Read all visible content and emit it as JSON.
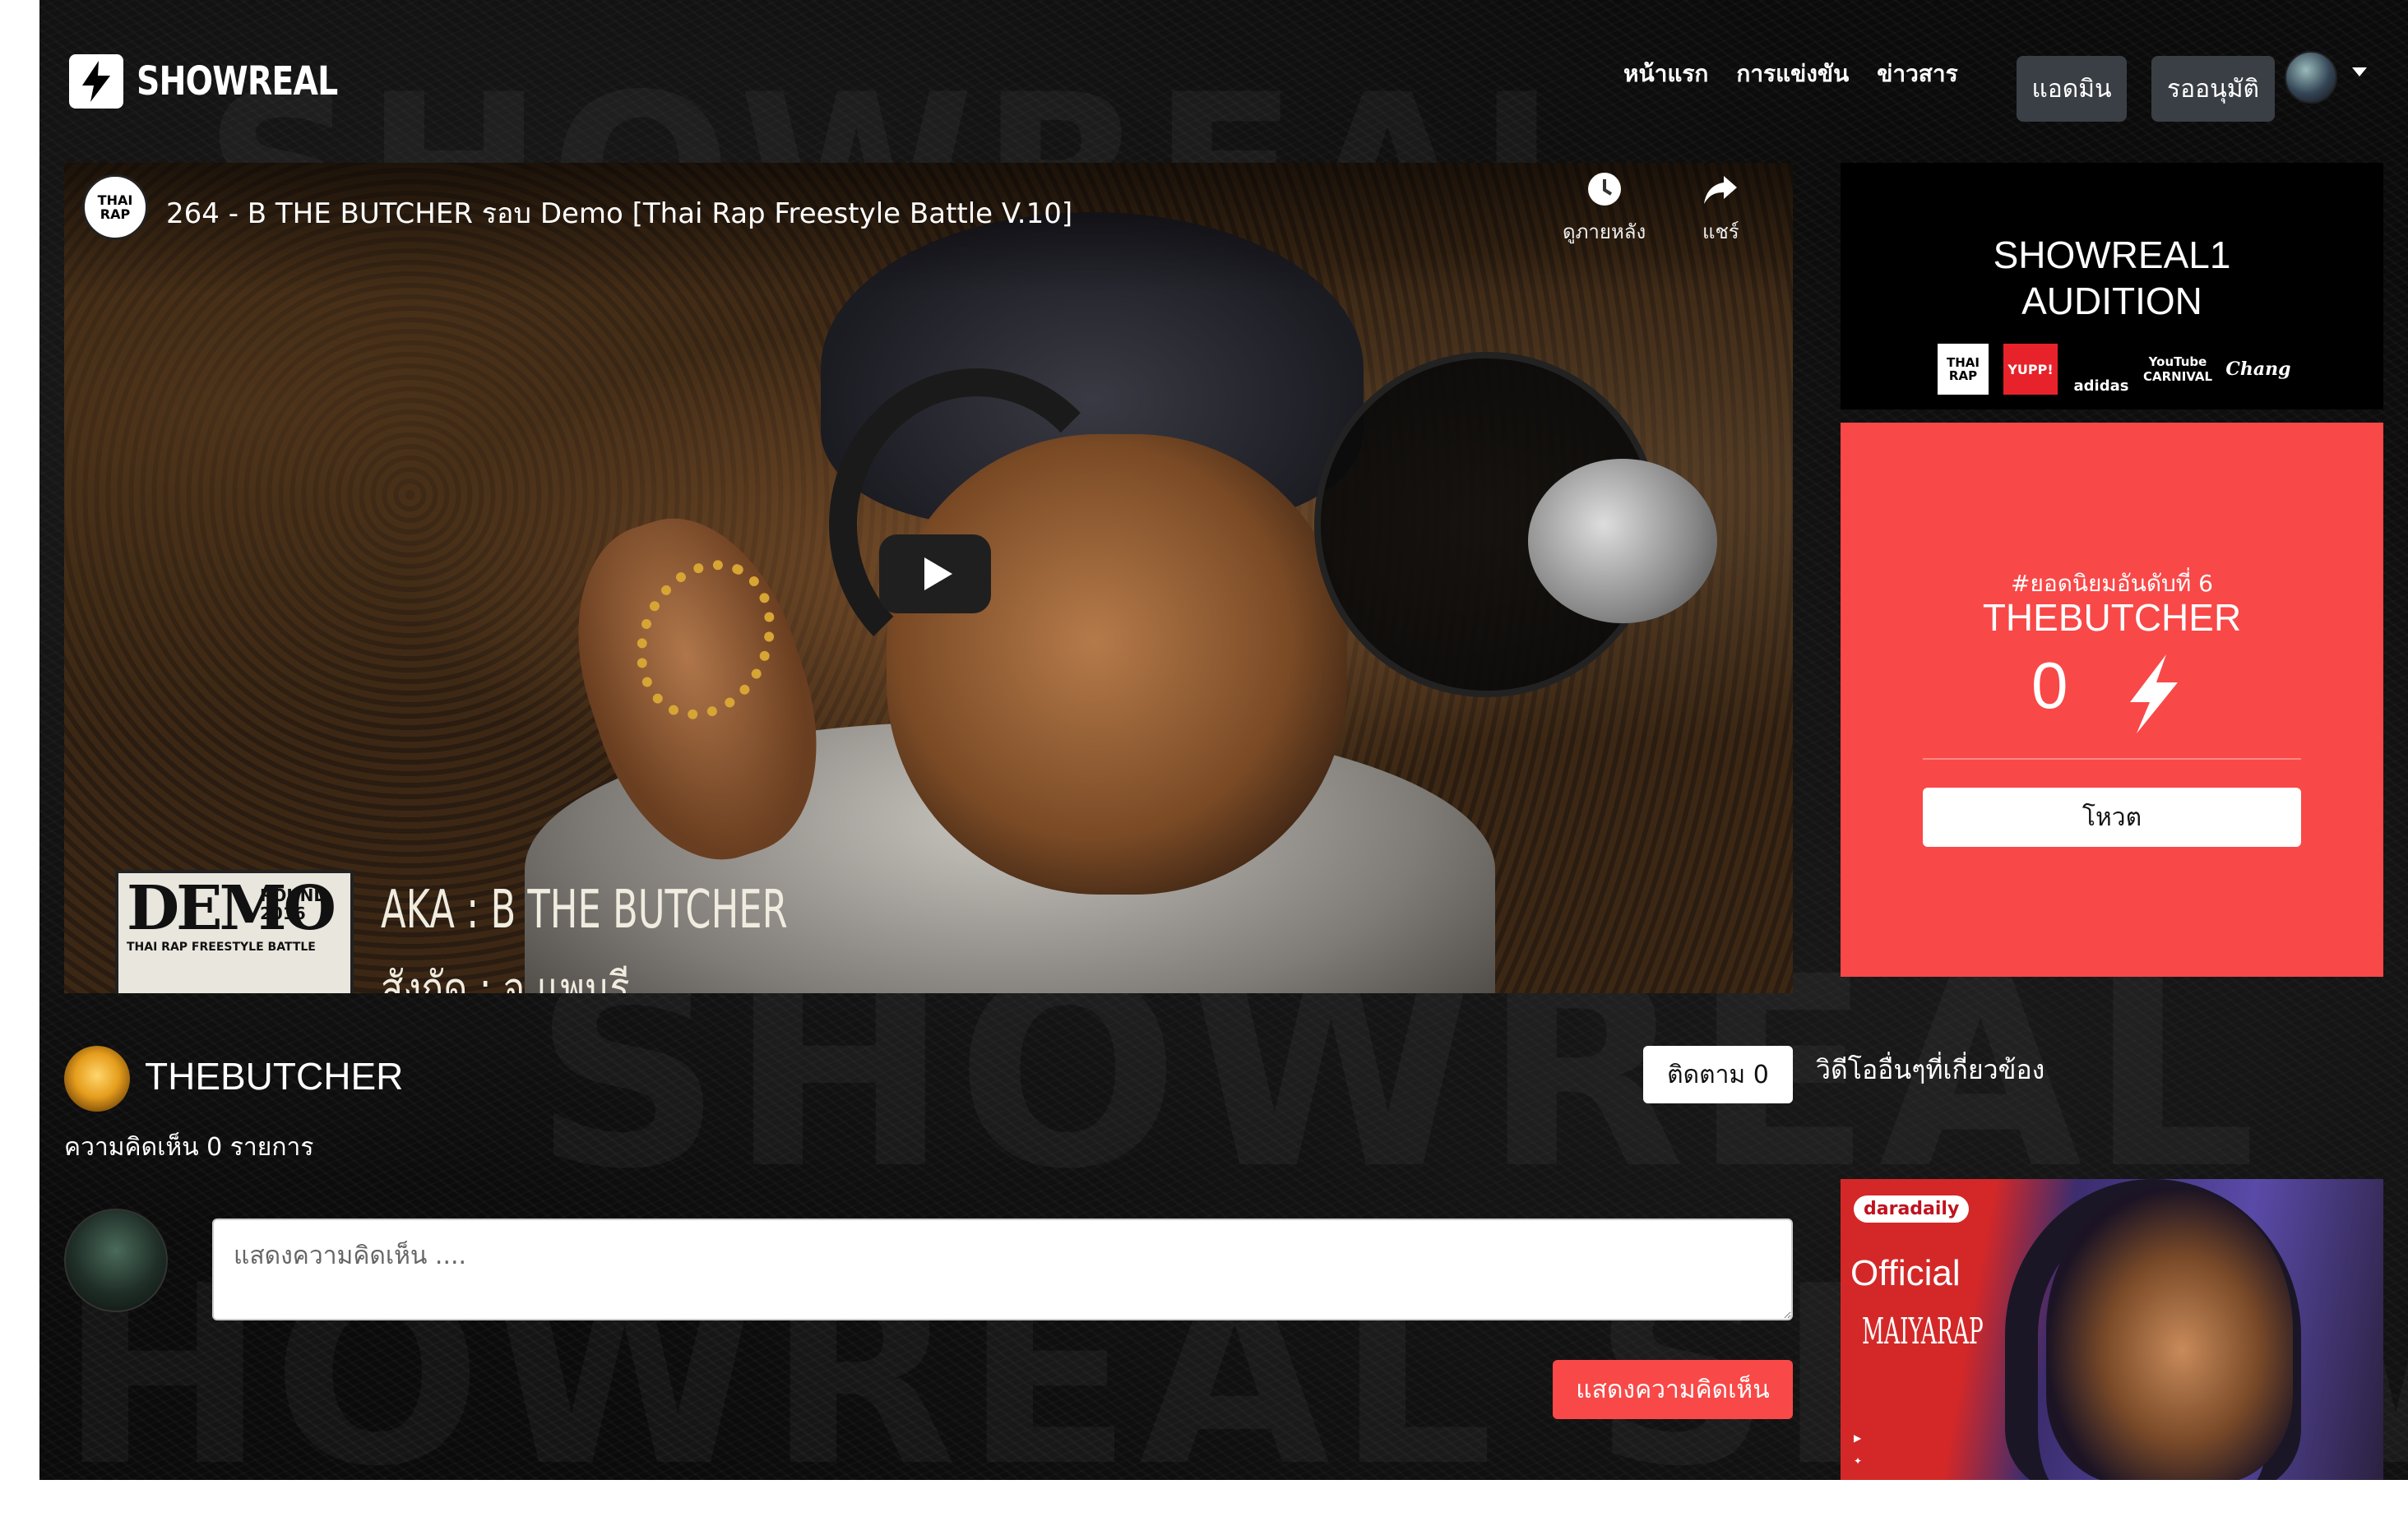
{
  "nav": {
    "logo_text": "SHOWREAL",
    "links": [
      "หน้าแรก",
      "การแข่งขัน",
      "ข่าวสาร"
    ],
    "admin_button": "แอดมิน",
    "pending_button": "รออนุมัติ"
  },
  "video": {
    "channel_badge": "THAI RAP",
    "title": "264 - B THE BUTCHER รอบ Demo [Thai Rap Freestyle Battle V.10]",
    "watch_later": "ดูภายหลัง",
    "share": "แชร์",
    "demo_title": "DEMO",
    "demo_round": "ROUND",
    "demo_year": "2016",
    "demo_sub": "THAI RAP FREESTYLE BATTLE",
    "aka_text": "AKA : B THE BUTCHER",
    "aka_sub": "สังกัด : จ.แพนรี"
  },
  "sponsor": {
    "title_line1": "SHOWREAL1",
    "title_line2": "AUDITION",
    "logos": [
      "THAI RAP",
      "YUPP!",
      "adidas",
      "YouTube CARNIVAL",
      "Chang"
    ]
  },
  "vote": {
    "rank_text": "#ยอดนิยมอันดับที่ 6",
    "name": "THEBUTCHER",
    "count": "0",
    "button": "โหวต"
  },
  "profile": {
    "name": "THEBUTCHER",
    "follow_button": "ติดตาม 0",
    "comment_count": "ความคิดเห็น 0 รายการ"
  },
  "related": {
    "title": "วิดีโออื่นๆที่เกี่ยวข้อง",
    "thumb_badge": "daradaily",
    "thumb_official": "Official",
    "thumb_sub": "MAIYARAP"
  },
  "comment": {
    "placeholder": "แสดงความคิดเห็น ....",
    "submit": "แสดงความคิดเห็น"
  },
  "colors": {
    "accent_red": "#f94848",
    "nav_button": "#3a3f45",
    "background": "#0b0b0b"
  }
}
